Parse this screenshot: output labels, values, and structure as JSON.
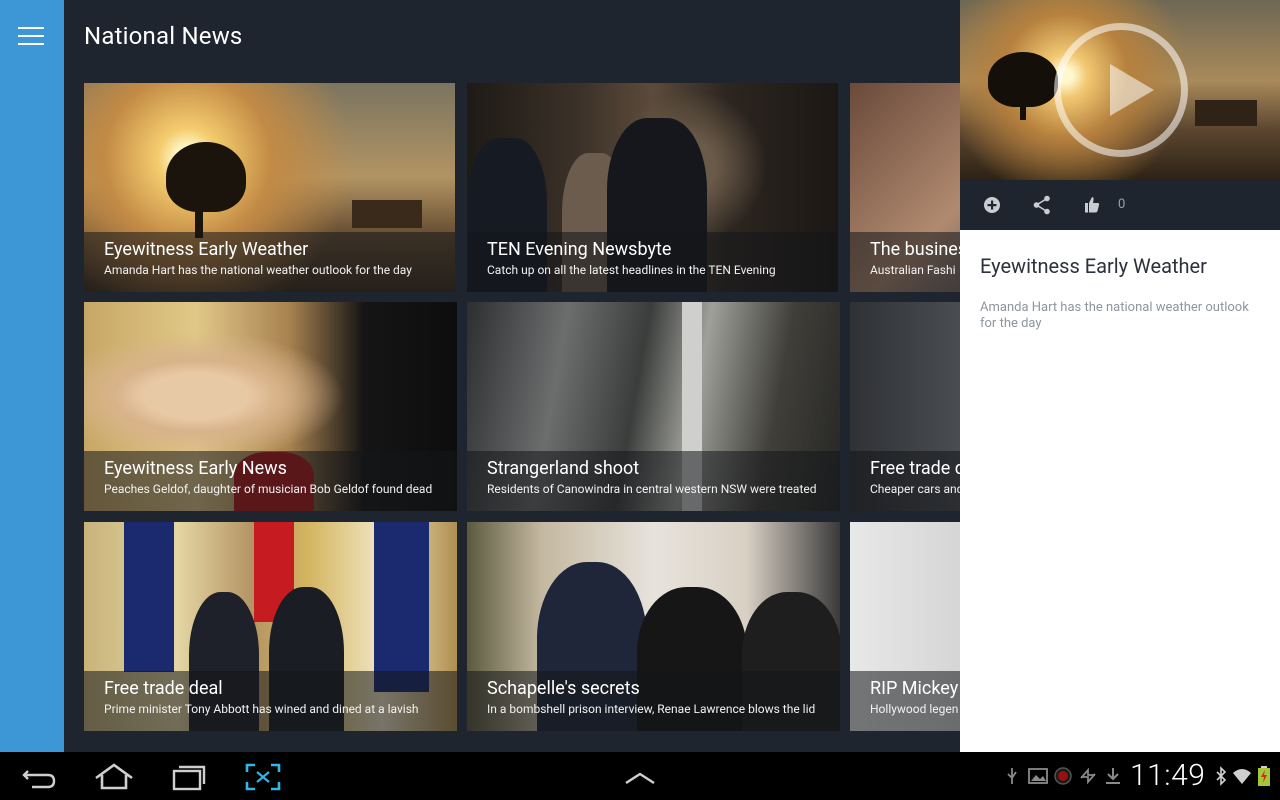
{
  "app": {
    "page_title": "National News"
  },
  "articles": [
    {
      "title": "Eyewitness Early Weather",
      "subtitle": "Amanda Hart has the national weather outlook for the day"
    },
    {
      "title": "TEN Evening Newsbyte",
      "subtitle": "Catch up on all the latest headlines in the TEN Evening"
    },
    {
      "title": "The busines",
      "subtitle": "Australian Fashi"
    },
    {
      "title": "Eyewitness Early News",
      "subtitle": "Peaches Geldof, daughter of musician Bob Geldof found dead"
    },
    {
      "title": "Strangerland shoot",
      "subtitle": "Residents of Canowindra in central western NSW were treated"
    },
    {
      "title": "Free trade d",
      "subtitle": "Cheaper cars and"
    },
    {
      "title": "Free trade deal",
      "subtitle": "Prime minister Tony Abbott has wined and dined at a lavish"
    },
    {
      "title": "Schapelle's secrets",
      "subtitle": "In a bombshell prison interview, Renae Lawrence blows the lid"
    },
    {
      "title": "RIP Mickey",
      "subtitle": "Hollywood legen"
    }
  ],
  "detail": {
    "title": "Eyewitness Early Weather",
    "description": "Amanda Hart has the national weather outlook for the day",
    "like_count": "0"
  },
  "status_bar": {
    "time": "11:49"
  },
  "colors": {
    "rail": "#3d97d7",
    "main_bg": "#1f252e",
    "accent_icon": "#33b5e5"
  }
}
